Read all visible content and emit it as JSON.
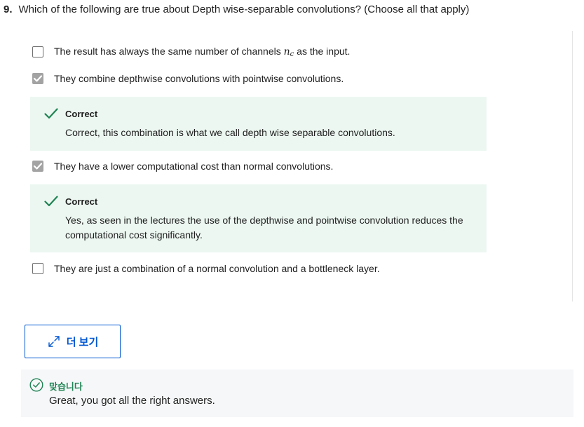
{
  "question": {
    "number": "9.",
    "text": "Which of the following are true about Depth wise-separable convolutions? (Choose all that apply)"
  },
  "options": [
    {
      "label_before": "The result has always the same number of channels",
      "math_base": "n",
      "math_sub": "c",
      "label_after": "as the input.",
      "checked": false
    },
    {
      "label": "They combine depthwise convolutions with pointwise convolutions.",
      "checked": true
    },
    {
      "label": "They have a lower computational cost than normal convolutions.",
      "checked": true
    },
    {
      "label": "They are just a combination of a normal convolution and a bottleneck layer.",
      "checked": false
    }
  ],
  "feedback": [
    {
      "status": "Correct",
      "text": "Correct, this combination is what we call depth wise separable convolutions."
    },
    {
      "status": "Correct",
      "text": "Yes, as seen in the lectures the use of the depthwise and pointwise convolution reduces the computational cost significantly."
    }
  ],
  "more_button": {
    "label": "더 보기",
    "icon": "expand-icon"
  },
  "result": {
    "status": "맞습니다",
    "message": "Great, you got all the right answers.",
    "icon": "check-circle-icon"
  },
  "colors": {
    "accent": "#0056d2",
    "success": "#1f8354",
    "feedback_bg": "#ecf7f1",
    "result_bg": "#f5f7f8"
  }
}
